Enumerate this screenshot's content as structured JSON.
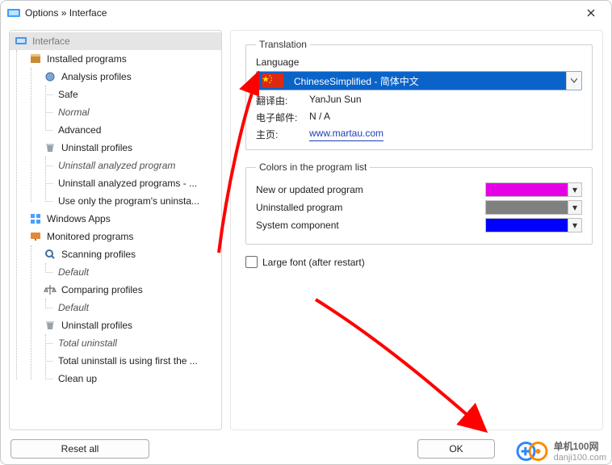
{
  "window": {
    "title": "Options » Interface"
  },
  "sidebar": {
    "root": "Interface",
    "nodes": [
      {
        "label": "Installed programs",
        "icon": "box-icon",
        "children": [
          {
            "label": "Analysis profiles",
            "icon": "profile-icon",
            "children": [
              {
                "label": "Safe"
              },
              {
                "label": "Normal",
                "italic": true
              },
              {
                "label": "Advanced"
              }
            ]
          },
          {
            "label": "Uninstall profiles",
            "icon": "trash-icon",
            "children": [
              {
                "label": "Uninstall analyzed program",
                "italic": true
              },
              {
                "label": "Uninstall analyzed programs - ..."
              },
              {
                "label": "Use only the program's uninsta..."
              }
            ]
          }
        ]
      },
      {
        "label": "Windows Apps",
        "icon": "apps-icon"
      },
      {
        "label": "Monitored programs",
        "icon": "monitor-icon",
        "children": [
          {
            "label": "Scanning profiles",
            "icon": "profile-icon",
            "children": [
              {
                "label": "Default",
                "italic": true
              }
            ]
          },
          {
            "label": "Comparing profiles",
            "icon": "scale-icon",
            "children": [
              {
                "label": "Default",
                "italic": true
              }
            ]
          },
          {
            "label": "Uninstall profiles",
            "icon": "trash-icon",
            "children": [
              {
                "label": "Total uninstall",
                "italic": true
              },
              {
                "label": "Total uninstall is using first the ..."
              },
              {
                "label": "Clean up"
              }
            ]
          }
        ]
      }
    ]
  },
  "main": {
    "translation": {
      "legend": "Translation",
      "language_label": "Language",
      "selected": "ChineseSimplified - 简体中文",
      "author_label": "翻译由:",
      "author": "YanJun Sun",
      "email_label": "电子邮件:",
      "email": "N / A",
      "homepage_label": "主页:",
      "homepage": "www.martau.com"
    },
    "colors": {
      "legend": "Colors in the program list",
      "rows": [
        {
          "label": "New or updated program",
          "color": "#e600e6"
        },
        {
          "label": "Uninstalled program",
          "color": "#808080"
        },
        {
          "label": "System component",
          "color": "#0000ff"
        }
      ]
    },
    "large_font_label": "Large font (after restart)",
    "large_font_checked": false
  },
  "buttons": {
    "reset": "Reset all",
    "ok": "OK"
  },
  "watermark": {
    "brand": "单机100网",
    "domain": "danji100.com"
  }
}
